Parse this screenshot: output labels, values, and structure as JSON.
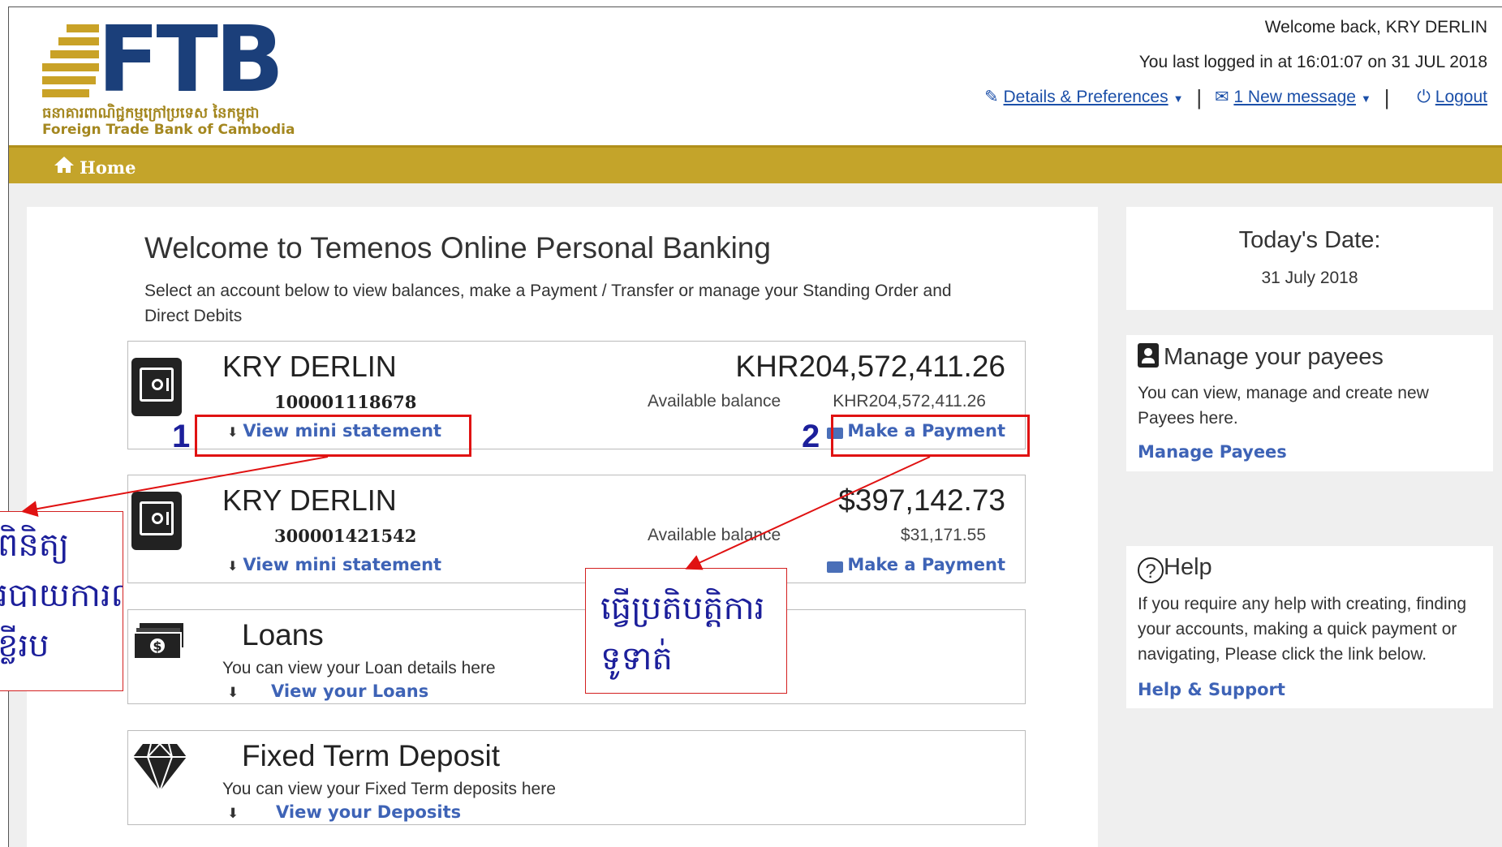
{
  "bank": {
    "logo_text": "FTB",
    "logo_khmer": "ធនាគារពាណិជ្ជកម្មក្រៅប្រទេស នៃកម្ពុជា",
    "logo_english": "Foreign Trade Bank of Cambodia"
  },
  "header": {
    "welcome": "Welcome back, KRY DERLIN",
    "last_login": "You last logged in at 16:01:07 on 31 JUL 2018",
    "details_link": "Details & Preferences",
    "messages_link": "1 New message",
    "logout_link": "Logout"
  },
  "nav": {
    "home": "Home"
  },
  "intro": {
    "title": "Welcome to Temenos Online Personal Banking",
    "subtitle": "Select an account below to view balances, make a Payment / Transfer or manage your Standing Order and Direct Debits"
  },
  "accounts": [
    {
      "name": "KRY DERLIN",
      "balance": "KHR204,572,411.26",
      "number": "100001118678",
      "available_label": "Available balance",
      "available": "KHR204,572,411.26",
      "mini_statement": "View mini statement",
      "payment": "Make a Payment"
    },
    {
      "name": "KRY DERLIN",
      "balance": "$397,142.73",
      "number": "300001421542",
      "available_label": "Available balance",
      "available": "$31,171.55",
      "mini_statement": "View mini statement",
      "payment": "Make a Payment"
    }
  ],
  "loans": {
    "title": "Loans",
    "desc": "You can view your Loan details here",
    "link": "View your Loans"
  },
  "deposits": {
    "title": "Fixed Term Deposit",
    "desc": "You can view your Fixed Term deposits here",
    "link": "View your Deposits"
  },
  "sidebar": {
    "today_label": "Today's Date:",
    "today_value": "31 July 2018",
    "payees_title": "Manage your payees",
    "payees_text": "You can view, manage and create new Payees here.",
    "payees_link": "Manage Payees",
    "help_title": "Help",
    "help_text": "If you require any help with creating, finding your accounts, making a quick payment or navigating, Please click the link below.",
    "help_link": "Help & Support"
  },
  "annotations": {
    "num1": "1",
    "num2": "2",
    "note1": "ពិនិត្យ\nរបាយការណ៍\nខ្លីរប",
    "note2": "ធ្វើប្រតិបត្តិការ\nទូទាត់"
  },
  "colors": {
    "gold": "#c4a42a",
    "navy": "#1b3f7a",
    "link_blue": "#3e63b6",
    "annotation_red": "#e01212",
    "annotation_blue": "#1c1f9b"
  }
}
